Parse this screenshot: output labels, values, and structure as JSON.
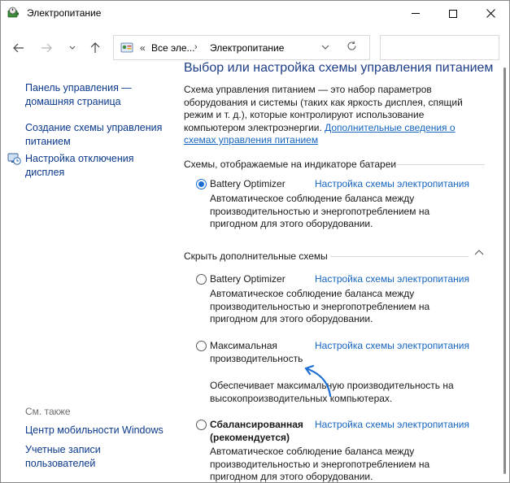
{
  "window": {
    "title": "Электропитание",
    "icon": "power-options-icon"
  },
  "address": {
    "separator": "«",
    "crumb1": "Все эле...",
    "crumb2": "Электропитание",
    "search_placeholder": ""
  },
  "sidebar": {
    "home_line1": "Панель управления —",
    "home_line2": "домашняя страница",
    "create_line1": "Создание схемы управления",
    "create_line2": "питанием",
    "off_line1": "Настройка отключения",
    "off_line2": "дисплея",
    "see_also": "См. также",
    "mobility": "Центр мобильности Windows",
    "accounts_line1": "Учетные записи",
    "accounts_line2": "пользователей"
  },
  "main": {
    "heading": "Выбор или настройка схемы управления питанием",
    "intro_line1": "Схема управления питанием — это набор параметров",
    "intro_line2": "оборудования и системы (таких как яркость дисплея, спящий",
    "intro_line3": "режим и т. д.), которые контролируют использование",
    "intro_line4_text": "компьютером электроэнергии. ",
    "intro_link1": "Дополнительные сведения о",
    "intro_link2": "схемах управления питанием",
    "section_battery": "Схемы, отображаемые на индикаторе батареи",
    "section_hidden": "Скрыть дополнительные схемы",
    "plan_link_label": "Настройка схемы электропитания"
  },
  "plans": {
    "battery_shown": {
      "name": "Battery Optimizer",
      "desc1": "Автоматическое соблюдение баланса между",
      "desc2": "производительностью и энергопотреблением на",
      "desc3": "пригодном для этого оборудовании.",
      "selected": true
    },
    "battery_hidden": {
      "name": "Battery Optimizer",
      "desc1": "Автоматическое соблюдение баланса между",
      "desc2": "производительностью и энергопотреблением на",
      "desc3": "пригодном для этого оборудовании.",
      "selected": false
    },
    "max_perf": {
      "name1": "Максимальная",
      "name2": "производительность",
      "desc1": "Обеспечивает максимальную производительность на",
      "desc2": "высокопроизводительных компьютерах.",
      "selected": false
    },
    "balanced": {
      "name1": "Сбалансированная",
      "name2": "(рекомендуется)",
      "desc1": "Автоматическое соблюдение баланса между",
      "desc2": "производительностью и энергопотреблением на",
      "desc3": "пригодном для этого оборудовании.",
      "selected": false
    }
  },
  "colors": {
    "link": "#1565c0",
    "heading": "#1e3e87",
    "radio_selected": "#1a6fd2"
  }
}
